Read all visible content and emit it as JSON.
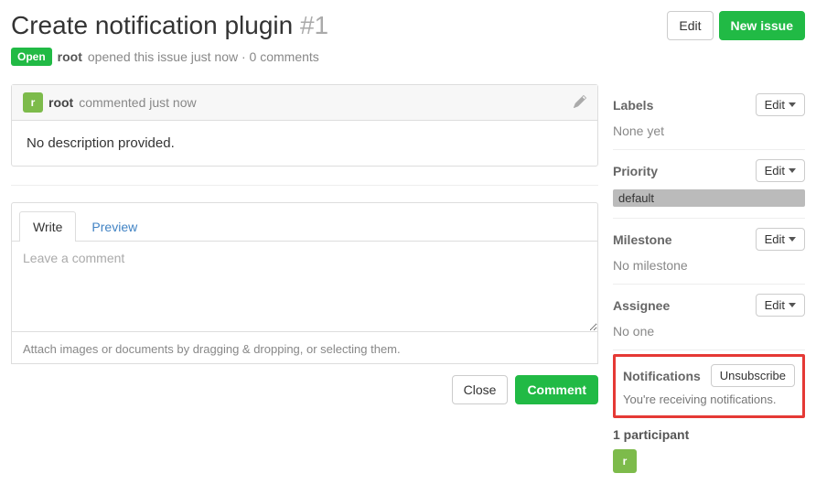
{
  "header": {
    "title": "Create notification plugin",
    "issue_number": "#1",
    "edit_label": "Edit",
    "new_issue_label": "New issue"
  },
  "meta": {
    "state": "Open",
    "author": "root",
    "opened_text": "opened this issue just now · 0 comments"
  },
  "comment": {
    "author": "root",
    "avatar_letter": "r",
    "time_text": "commented just now",
    "body": "No description provided."
  },
  "editor": {
    "tab_write": "Write",
    "tab_preview": "Preview",
    "placeholder": "Leave a comment",
    "attach_hint": "Attach images or documents by dragging & dropping, or selecting them.",
    "close_label": "Close",
    "comment_label": "Comment"
  },
  "sidebar": {
    "labels": {
      "title": "Labels",
      "edit": "Edit",
      "value": "None yet"
    },
    "priority": {
      "title": "Priority",
      "edit": "Edit",
      "value": "default"
    },
    "milestone": {
      "title": "Milestone",
      "edit": "Edit",
      "value": "No milestone"
    },
    "assignee": {
      "title": "Assignee",
      "edit": "Edit",
      "value": "No one"
    },
    "notifications": {
      "title": "Notifications",
      "button": "Unsubscribe",
      "text": "You're receiving notifications."
    },
    "participants": {
      "label": "1 participant",
      "avatar_letter": "r"
    }
  }
}
